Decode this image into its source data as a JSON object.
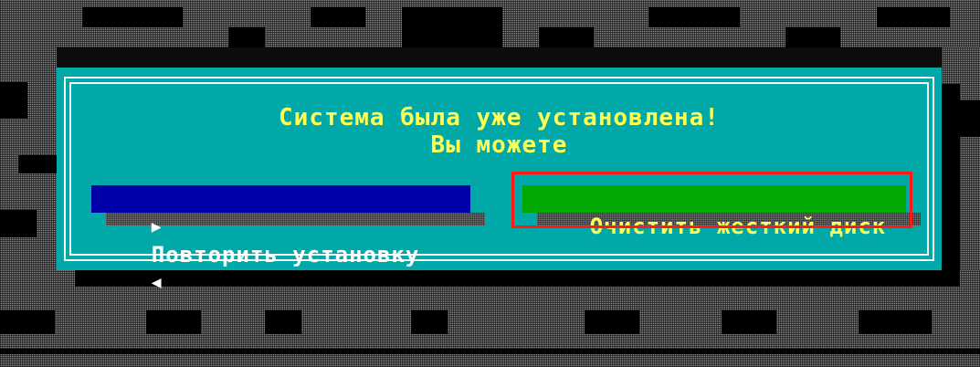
{
  "dialog": {
    "message_line1": "Система была уже установлена!",
    "message_line2": "Вы можете"
  },
  "buttons": {
    "reinstall_label": "Повторить установку",
    "clear_disk_label": "Очистить жесткий диск",
    "left_arrow_icon": "▶",
    "right_arrow_icon": "◀"
  },
  "colors": {
    "dialog_bg": "#00a8a8",
    "message_text": "#ffff55",
    "reinstall_bg": "#0000aa",
    "clear_disk_bg": "#00aa00",
    "focus_highlight": "#ff1a1a"
  }
}
